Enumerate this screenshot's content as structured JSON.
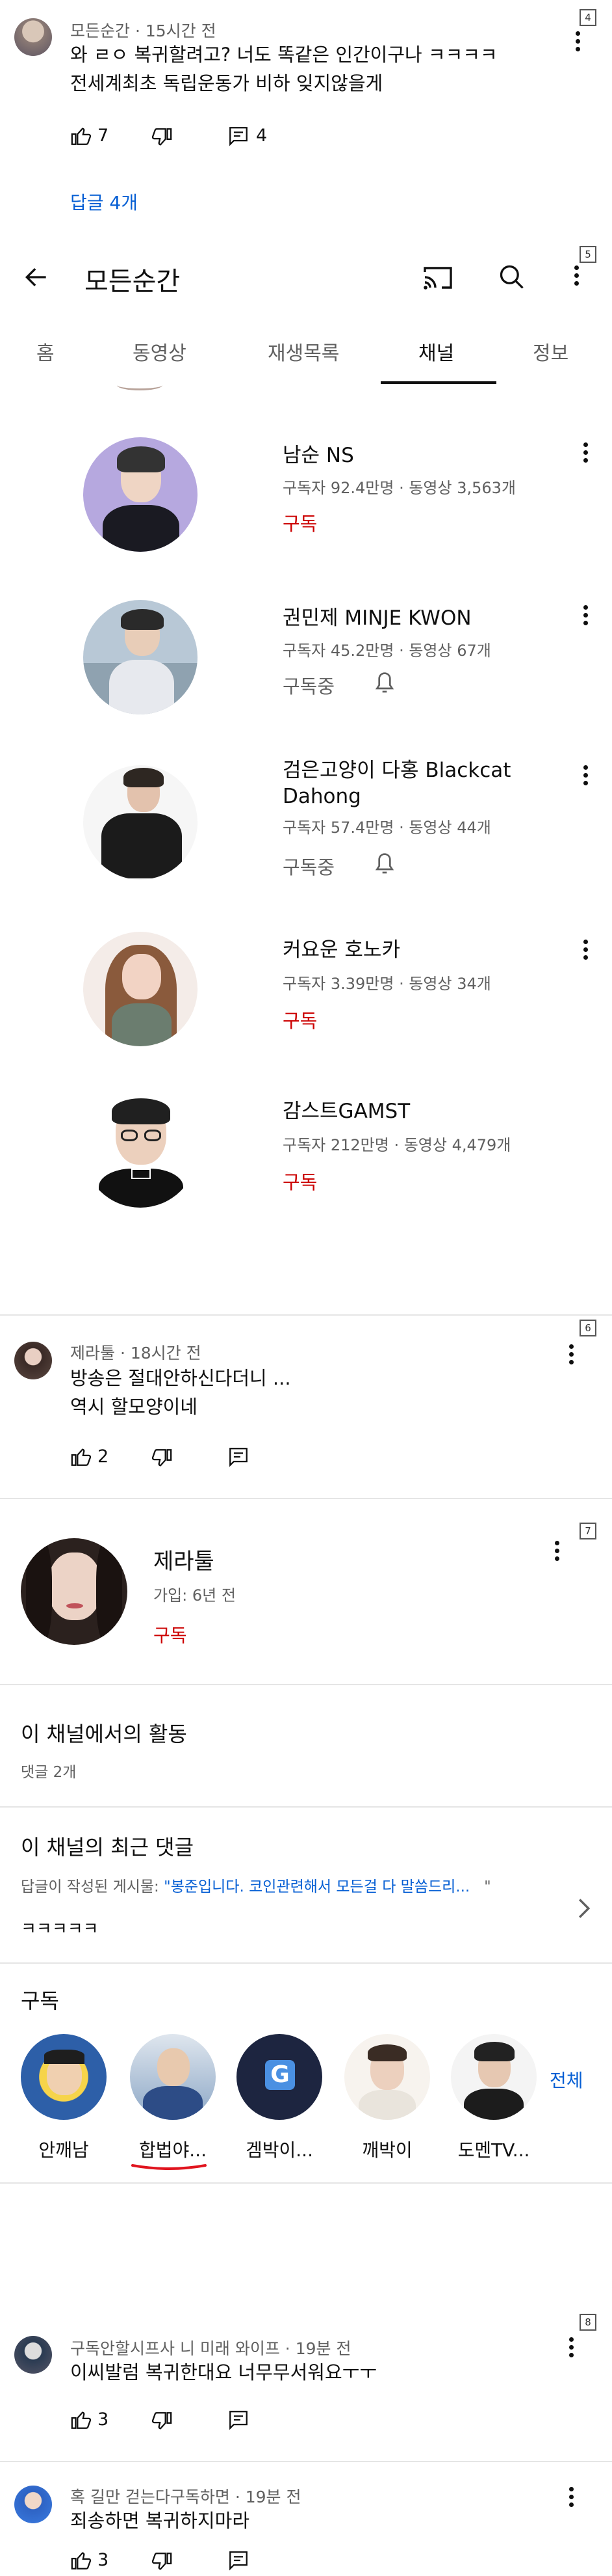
{
  "section4": {
    "badge": "4",
    "author": "모든순간",
    "time": "15시간 전",
    "line1": "와 ㄹㅇ 복귀할려고? 너도 똑같은 인간이구나 ㅋㅋㅋㅋ",
    "line2": "전세계최초 독립운동가 비하 잊지않을게",
    "likes": "7",
    "replies_count": "4",
    "replies_link": "답글 4개"
  },
  "section5": {
    "badge": "5",
    "title": "모든순간",
    "tabs": [
      "홈",
      "동영상",
      "재생목록",
      "채널",
      "정보"
    ],
    "active_tab": "채널",
    "channels": [
      {
        "name": "남순 NS",
        "stats": "구독자 92.4만명 · 동영상 3,563개",
        "action": "구독"
      },
      {
        "name": "권민제 MINJE KWON",
        "stats": "구독자 45.2만명 · 동영상 67개",
        "action": "구독중"
      },
      {
        "name": "검은고양이 다홍 Blackcat Dahong",
        "name_line1": "검은고양이 다홍 Blackcat",
        "name_line2": "Dahong",
        "stats": "구독자 57.4만명 · 동영상 44개",
        "action": "구독중"
      },
      {
        "name": "커요운 호노카",
        "stats": "구독자 3.39만명 · 동영상 34개",
        "action": "구독"
      },
      {
        "name": "감스트GAMST",
        "stats": "구독자 212만명 · 동영상 4,479개",
        "action": "구독"
      }
    ]
  },
  "section6": {
    "badge": "6",
    "author": "제라툴",
    "time": "18시간 전",
    "line1": "방송은 절대안하신다더니  ...",
    "line2": "역시 할모양이네",
    "likes": "2"
  },
  "section7": {
    "badge": "7",
    "name": "제라툴",
    "joined": "가입: 6년 전",
    "subscribe": "구독",
    "activity_title": "이 채널에서의 활동",
    "activity_sub": "댓글 2개",
    "recent_title": "이 채널의 최근 댓글",
    "recent_prefix": "답글이 작성된 게시물: ",
    "recent_link": "\"봉준입니다. 코인관련해서 모든걸 다 말씀드리...",
    "recent_quote_end": "\"",
    "recent_comment": "ㅋㅋㅋㅋㅋ",
    "subs_title": "구독",
    "subs_all": "전체",
    "subs": [
      "안깨남",
      "합법야...",
      "겜박이...",
      "깨박이",
      "도멘TV..."
    ]
  },
  "section8": {
    "badge": "8",
    "c1_author": "구독안할시프사 니 미래 와이프",
    "c1_time": "19분 전",
    "c1_text": "이씨발럼 복귀한대요 너무무서워요ㅜㅜ",
    "c1_likes": "3",
    "c2_author": "혹 길만 걷는다구독하면",
    "c2_time": "19분 전",
    "c2_text": "죄송하면 복귀하지마라",
    "c2_likes": "3"
  },
  "colors": {
    "link_blue": "#065fd4",
    "subscribe_red": "#cc0000",
    "underline_red": "#e0141e",
    "text": "#0f0f0f",
    "muted": "#606060"
  }
}
